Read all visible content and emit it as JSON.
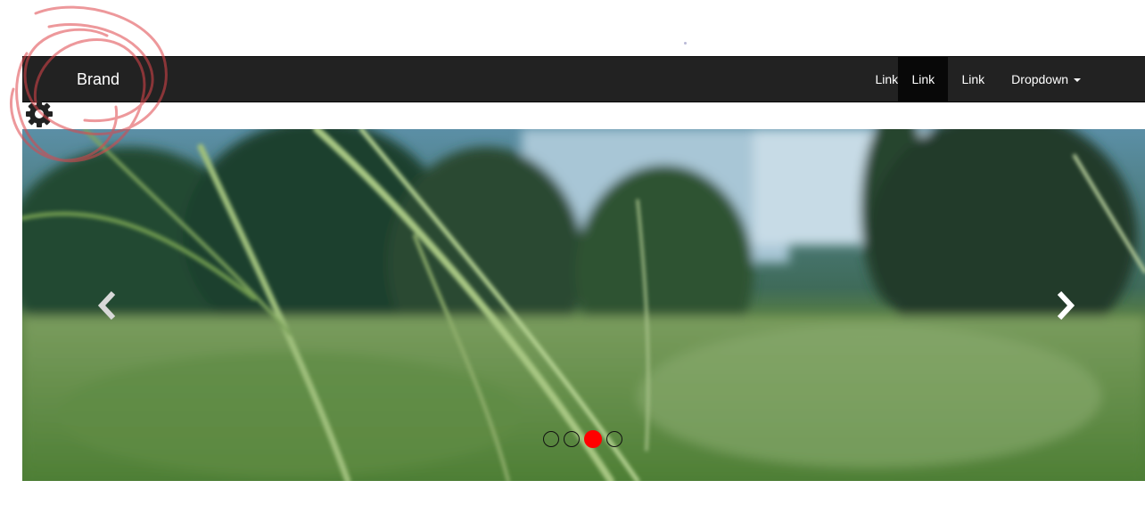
{
  "navbar": {
    "brand": "Brand",
    "links": [
      {
        "label": "Link"
      },
      {
        "label": "Link",
        "active": true
      },
      {
        "label": "Link"
      }
    ],
    "dropdown": {
      "label": "Dropdown",
      "icon": "caret-down-icon"
    }
  },
  "settings": {
    "icon": "gear-icon"
  },
  "carousel": {
    "prev_icon": "chevron-left-icon",
    "next_icon": "chevron-right-icon",
    "slide_count": 4,
    "active_index": 2,
    "active_color": "#ff0000"
  },
  "annotation": {
    "color": "#e0454a"
  }
}
